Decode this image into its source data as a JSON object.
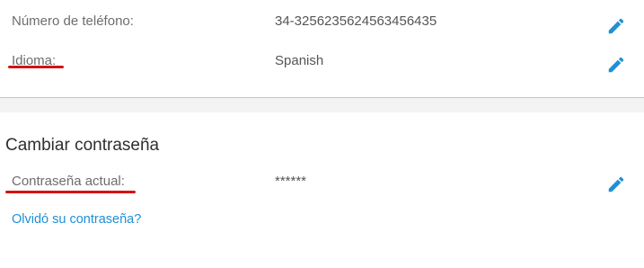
{
  "personal_info": {
    "phone": {
      "label": "Número de teléfono:",
      "value": "34-3256235624563456435"
    },
    "language": {
      "label": "Idioma:",
      "value": "Spanish"
    }
  },
  "password_section": {
    "title": "Cambiar contraseña",
    "current_password": {
      "label": "Contraseña actual:",
      "value": "******"
    },
    "forgot_link": "Olvidó su contraseña?"
  },
  "icons": {
    "edit": "pencil-icon"
  },
  "colors": {
    "accent": "#1f8fd8",
    "annotation": "#d71313",
    "label": "#6d6d6d",
    "value": "#555555",
    "divider_band": "#f3f3f3"
  }
}
